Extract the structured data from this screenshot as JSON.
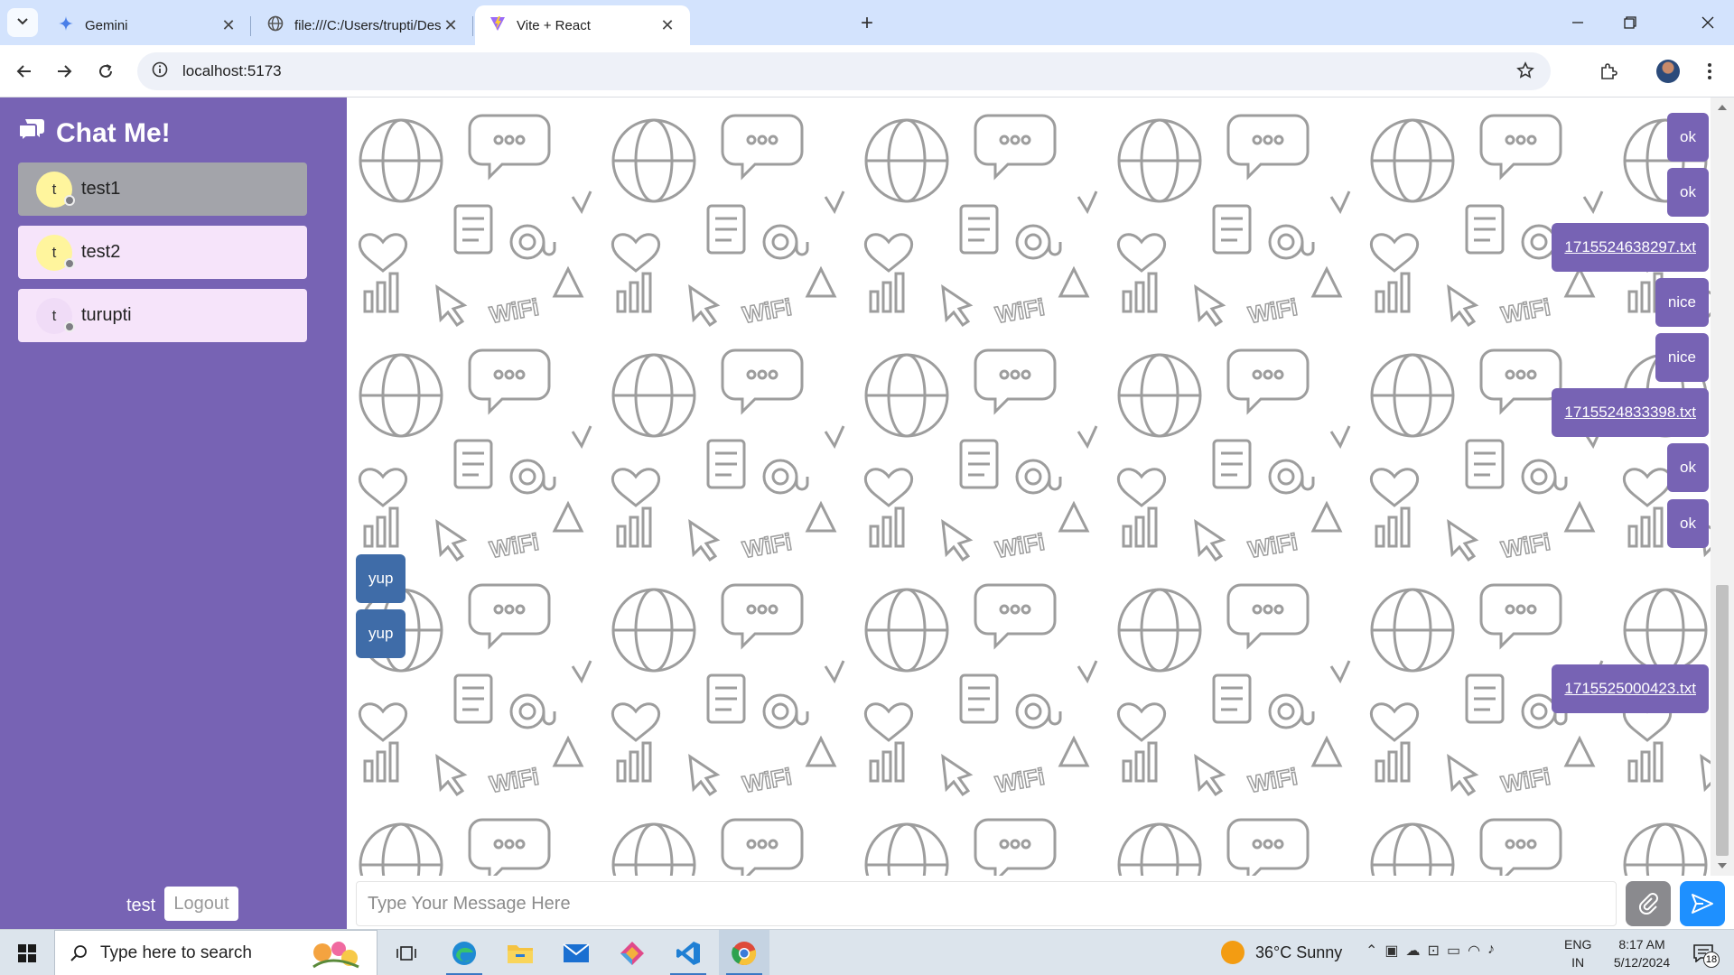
{
  "browser": {
    "tabs": [
      {
        "label": "Gemini",
        "icon": "gemini-icon",
        "active": false
      },
      {
        "label": "file:///C:/Users/trupti/Desktop/",
        "icon": "globe-icon",
        "active": false
      },
      {
        "label": "Vite + React",
        "icon": "vite-icon",
        "active": true
      }
    ],
    "address": "localhost:5173"
  },
  "app": {
    "brand": "Chat Me!",
    "users": [
      {
        "initial": "t",
        "name": "test1",
        "selected": true,
        "avatar_color": "#fff59d"
      },
      {
        "initial": "t",
        "name": "test2",
        "selected": false,
        "avatar_color": "#fff59d"
      },
      {
        "initial": "t",
        "name": "turupti",
        "selected": false,
        "avatar_color": "#f0dcf7"
      }
    ],
    "current_user": "test",
    "logout_label": "Logout",
    "messages": [
      {
        "text": "ok",
        "side": "sent",
        "type": "text"
      },
      {
        "text": "ok",
        "side": "sent",
        "type": "text"
      },
      {
        "text": "1715524638297.txt",
        "side": "sent",
        "type": "file"
      },
      {
        "text": "nice",
        "side": "sent",
        "type": "text"
      },
      {
        "text": "nice",
        "side": "sent",
        "type": "text"
      },
      {
        "text": "1715524833398.txt",
        "side": "sent",
        "type": "file"
      },
      {
        "text": "ok",
        "side": "sent",
        "type": "text"
      },
      {
        "text": "ok",
        "side": "sent",
        "type": "text"
      },
      {
        "text": "yup",
        "side": "recv",
        "type": "text"
      },
      {
        "text": "yup",
        "side": "recv",
        "type": "text"
      },
      {
        "text": "1715525000423.txt",
        "side": "sent",
        "type": "file"
      }
    ],
    "input_placeholder": "Type Your Message Here",
    "colors": {
      "sidebar": "#7763b4",
      "sent": "#7763b4",
      "received": "#3f6ca8",
      "send_button": "#1e90ff"
    }
  },
  "taskbar": {
    "search_placeholder": "Type here to search",
    "weather": "36°C  Sunny",
    "lang_1": "ENG",
    "lang_2": "IN",
    "time": "8:17 AM",
    "date": "5/12/2024",
    "notifications": "18"
  }
}
